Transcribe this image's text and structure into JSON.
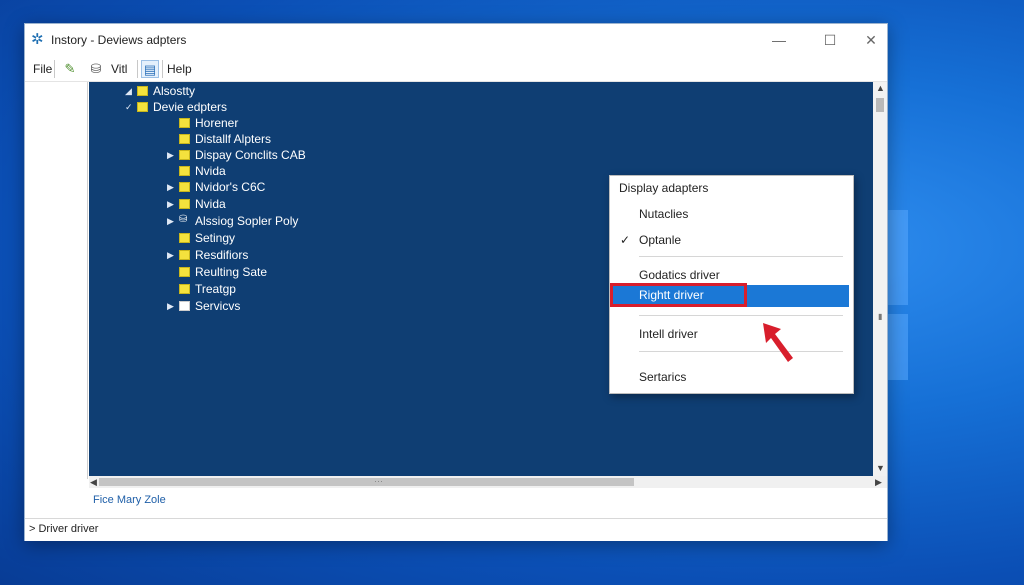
{
  "window": {
    "title": "Instory - Deviews adpters",
    "controls": {
      "minimize": "—",
      "maximize": "☐",
      "close": "✕"
    }
  },
  "menubar": {
    "file": "File",
    "vitl": "Vitl",
    "help": "Help"
  },
  "tree": [
    {
      "label": "Alsostty",
      "expander": "◢",
      "folder": "yellow"
    },
    {
      "label": "Devie edpters",
      "expander": "✓",
      "folder": "yellow"
    },
    {
      "label": "Horener",
      "expander": "",
      "folder": "yellow"
    },
    {
      "label": "Distallf Alpters",
      "expander": "",
      "folder": "yellow"
    },
    {
      "label": "Dispay Conclits CAB",
      "expander": "▶",
      "folder": "yellow"
    },
    {
      "label": "Nvida",
      "expander": "",
      "folder": "yellow"
    },
    {
      "label": "Nvidor's C6C",
      "expander": "▶",
      "folder": "yellow"
    },
    {
      "label": "Nvida",
      "expander": "▶",
      "folder": "yellow"
    },
    {
      "label": "Alssiog Sopler Poly",
      "expander": "▶",
      "folder": "device"
    },
    {
      "label": "Setingy",
      "expander": "",
      "folder": "yellow"
    },
    {
      "label": "Resdifiors",
      "expander": "▶",
      "folder": "yellow"
    },
    {
      "label": "Reulting Sate",
      "expander": "",
      "folder": "yellow"
    },
    {
      "label": "Treatgp",
      "expander": "",
      "folder": "yellow"
    },
    {
      "label": "Servicvs",
      "expander": "▶",
      "folder": "white"
    }
  ],
  "context_menu": {
    "header": "Display adapters",
    "items": {
      "nutaclies": "Nutaclies",
      "checkmark": "✓",
      "optanle": "Optanle",
      "godatics": "Godatics driver",
      "rightt": "Rightt driver",
      "intell": "Intell driver",
      "sertarics": "Sertarics"
    }
  },
  "status": {
    "text": "Fice Mary Zole"
  },
  "bottom": {
    "text": "> Driver driver"
  },
  "colors": {
    "tree_bg": "#0f3e73",
    "highlight": "#1b78d6",
    "annotation": "#d81e2c",
    "folder": "#f4e23d"
  }
}
